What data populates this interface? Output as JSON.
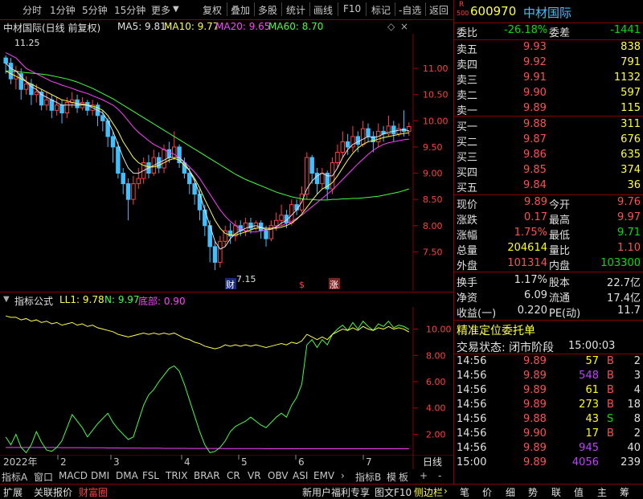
{
  "toolbar": {
    "left": [
      "分时",
      "1分钟",
      "5分钟",
      "15分钟",
      "更多"
    ],
    "right": [
      "复权",
      "叠加",
      "多股",
      "统计",
      "画线",
      "F10",
      "标记",
      "-自选",
      "返回"
    ]
  },
  "main_legend": {
    "title": "中材国际(日线 前复权)",
    "ma5": "MA5: 9.81",
    "ma10": "MA10: 9.77",
    "ma20": "MA20: 9.65",
    "ma60": "MA60: 8.70",
    "high_label": "11.25",
    "low_label": "7.15",
    "badges": [
      "财",
      "$",
      "涨"
    ]
  },
  "price_axis": [
    "11.00",
    "10.50",
    "10.00",
    "9.50",
    "9.00",
    "8.50",
    "8.00",
    "7.50"
  ],
  "indicator_legend": {
    "name": "指标公式",
    "ll1": "LL1: 9.78",
    "n": "N: 9.97",
    "dibu": "底部: 0.90"
  },
  "indicator_axis": [
    "10.00",
    "8.00",
    "6.00",
    "4.00",
    "2.00"
  ],
  "date_axis": {
    "year": "2022年",
    "months": [
      "2",
      "3",
      "4",
      "5",
      "6",
      "7"
    ],
    "period": "日线"
  },
  "bottom_tabs": [
    "指标A",
    "窗口",
    "MACD",
    "DMI",
    "DMA",
    "FSL",
    "TRIX",
    "BRAR",
    "CR",
    "VR",
    "OBV",
    "ASI",
    "EMV"
  ],
  "bottom_tabs_right": [
    "指标B",
    "模",
    "板",
    "+",
    "-"
  ],
  "status_left": [
    "扩展",
    "关联报价",
    "财富圈"
  ],
  "status_right": [
    "新用户福利专享",
    "图文F10",
    "侧边栏"
  ],
  "status_icons": [
    "笔",
    "价",
    "细",
    "势",
    "联",
    "值",
    "主",
    "筹"
  ],
  "quote": {
    "r_label": "R",
    "r_num": "500",
    "code": "600970",
    "name": "中材国际",
    "weibi_label": "委比",
    "weibi": "-26.18%",
    "weicha_label": "委差",
    "weicha": "-1441",
    "asks": [
      {
        "label": "卖五",
        "price": "9.93",
        "vol": "838"
      },
      {
        "label": "卖四",
        "price": "9.92",
        "vol": "791"
      },
      {
        "label": "卖三",
        "price": "9.91",
        "vol": "1132"
      },
      {
        "label": "卖二",
        "price": "9.90",
        "vol": "597"
      },
      {
        "label": "卖一",
        "price": "9.89",
        "vol": "115"
      }
    ],
    "bids": [
      {
        "label": "买一",
        "price": "9.88",
        "vol": "311"
      },
      {
        "label": "买二",
        "price": "9.87",
        "vol": "676"
      },
      {
        "label": "买三",
        "price": "9.86",
        "vol": "635"
      },
      {
        "label": "买四",
        "price": "9.85",
        "vol": "374"
      },
      {
        "label": "买五",
        "price": "9.84",
        "vol": "36"
      }
    ],
    "stats": [
      {
        "l1": "现价",
        "v1": "9.89",
        "l2": "今开",
        "v2": "9.76",
        "c1": "#ff5050",
        "c2": "#ff5050"
      },
      {
        "l1": "涨跌",
        "v1": "0.17",
        "l2": "最高",
        "v2": "9.97",
        "c1": "#ff5050",
        "c2": "#ff5050"
      },
      {
        "l1": "涨幅",
        "v1": "1.75%",
        "l2": "最低",
        "v2": "9.71",
        "c1": "#ff5050",
        "c2": "#00e000"
      },
      {
        "l1": "总量",
        "v1": "204614",
        "l2": "量比",
        "v2": "1.10",
        "c1": "#ffff00",
        "c2": "#ff5050"
      },
      {
        "l1": "外盘",
        "v1": "101314",
        "l2": "内盘",
        "v2": "103300",
        "c1": "#ff5050",
        "c2": "#00e000"
      }
    ],
    "fin": [
      {
        "l1": "换手",
        "v1": "1.17%",
        "l2": "股本",
        "v2": "22.7亿"
      },
      {
        "l1": "净资",
        "v1": "6.09",
        "l2": "流通",
        "v2": "17.4亿"
      },
      {
        "l1": "收益(一)",
        "v1": "0.220",
        "l2": "PE(动)",
        "v2": "11.7"
      }
    ],
    "precise_title": "精准定位委托单",
    "trade_status_label": "交易状态: 闭市阶段",
    "trade_status_time": "15:00:03",
    "ticks": [
      {
        "t": "14:56",
        "p": "9.89",
        "v": "57",
        "s": "B",
        "n": "2",
        "vc": "#ffff00"
      },
      {
        "t": "14:56",
        "p": "9.89",
        "v": "548",
        "s": "B",
        "n": "3",
        "vc": "#c040ff"
      },
      {
        "t": "14:56",
        "p": "9.89",
        "v": "61",
        "s": "B",
        "n": "4",
        "vc": "#ffff00"
      },
      {
        "t": "14:56",
        "p": "9.89",
        "v": "273",
        "s": "B",
        "n": "18",
        "vc": "#ffff00"
      },
      {
        "t": "14:56",
        "p": "9.88",
        "v": "43",
        "s": "S",
        "n": "8",
        "vc": "#ffff00"
      },
      {
        "t": "14:56",
        "p": "9.90",
        "v": "17",
        "s": "B",
        "n": "2",
        "vc": "#ffff00"
      },
      {
        "t": "14:56",
        "p": "9.89",
        "v": "945",
        "s": "",
        "n": "40",
        "vc": "#c040ff"
      },
      {
        "t": "15:00",
        "p": "9.89",
        "v": "4056",
        "s": "",
        "n": "239",
        "vc": "#c040ff"
      }
    ]
  },
  "chart_data": {
    "type": "candlestick",
    "ylim": [
      7.0,
      11.6
    ],
    "candles": [
      [
        11.2,
        11.1,
        11.25,
        10.9
      ],
      [
        11.1,
        10.8,
        11.2,
        10.7
      ],
      [
        10.8,
        10.95,
        11.05,
        10.6
      ],
      [
        10.9,
        10.6,
        11.0,
        10.4
      ],
      [
        10.6,
        10.7,
        10.85,
        10.5
      ],
      [
        10.7,
        10.5,
        10.8,
        10.3
      ],
      [
        10.5,
        10.55,
        10.7,
        10.35
      ],
      [
        10.55,
        10.3,
        10.6,
        10.2
      ],
      [
        10.3,
        10.4,
        10.55,
        10.2
      ],
      [
        10.4,
        10.2,
        10.5,
        10.05
      ],
      [
        10.2,
        10.3,
        10.45,
        10.1
      ],
      [
        10.3,
        10.15,
        10.4,
        9.95
      ],
      [
        10.15,
        10.35,
        10.45,
        10.05
      ],
      [
        10.35,
        10.4,
        10.55,
        10.25
      ],
      [
        10.4,
        10.25,
        10.5,
        10.15
      ],
      [
        10.25,
        10.35,
        10.45,
        10.2
      ],
      [
        10.35,
        10.2,
        10.4,
        10.1
      ],
      [
        10.2,
        10.3,
        10.4,
        10.1
      ],
      [
        10.3,
        10.1,
        10.35,
        9.9
      ],
      [
        10.1,
        10.0,
        10.2,
        9.8
      ],
      [
        10.0,
        9.7,
        10.05,
        9.5
      ],
      [
        9.7,
        9.5,
        9.8,
        9.2
      ],
      [
        9.5,
        9.0,
        9.6,
        8.9
      ],
      [
        9.0,
        8.8,
        9.1,
        8.6
      ],
      [
        8.8,
        8.5,
        8.9,
        8.1
      ],
      [
        8.5,
        8.8,
        8.95,
        8.4
      ],
      [
        8.8,
        8.9,
        9.1,
        8.7
      ],
      [
        8.9,
        9.2,
        9.3,
        8.8
      ],
      [
        9.2,
        9.0,
        9.35,
        8.9
      ],
      [
        9.0,
        9.3,
        9.45,
        8.95
      ],
      [
        9.3,
        9.1,
        9.4,
        9.0
      ],
      [
        9.1,
        9.45,
        9.55,
        9.0
      ],
      [
        9.45,
        9.3,
        9.6,
        9.2
      ],
      [
        9.3,
        9.5,
        9.8,
        9.25
      ],
      [
        9.5,
        9.2,
        9.55,
        9.1
      ],
      [
        9.2,
        9.0,
        9.3,
        8.9
      ],
      [
        9.0,
        8.8,
        9.1,
        8.6
      ],
      [
        8.8,
        8.6,
        8.9,
        8.4
      ],
      [
        8.6,
        8.3,
        8.7,
        8.1
      ],
      [
        8.3,
        8.0,
        8.4,
        7.8
      ],
      [
        8.0,
        7.6,
        8.1,
        7.3
      ],
      [
        7.6,
        7.3,
        7.7,
        7.15
      ],
      [
        7.3,
        7.7,
        7.8,
        7.2
      ],
      [
        7.7,
        7.9,
        8.0,
        7.6
      ],
      [
        7.9,
        7.8,
        8.05,
        7.65
      ],
      [
        7.8,
        8.0,
        8.1,
        7.7
      ],
      [
        8.0,
        7.9,
        8.1,
        7.8
      ],
      [
        7.9,
        8.05,
        8.15,
        7.8
      ],
      [
        8.05,
        7.95,
        8.15,
        7.85
      ],
      [
        7.95,
        8.05,
        8.1,
        7.9
      ],
      [
        8.05,
        7.9,
        8.1,
        7.75
      ],
      [
        7.9,
        7.75,
        8.0,
        7.6
      ],
      [
        7.75,
        8.0,
        8.1,
        7.7
      ],
      [
        8.0,
        8.1,
        8.25,
        7.9
      ],
      [
        8.1,
        8.2,
        8.4,
        8.0
      ],
      [
        8.2,
        8.05,
        8.3,
        7.95
      ],
      [
        8.05,
        8.4,
        8.5,
        8.0
      ],
      [
        8.4,
        8.3,
        8.5,
        8.2
      ],
      [
        8.3,
        8.6,
        8.75,
        8.25
      ],
      [
        8.6,
        9.3,
        9.4,
        8.5
      ],
      [
        9.3,
        9.0,
        9.35,
        8.8
      ],
      [
        9.0,
        8.8,
        9.1,
        8.6
      ],
      [
        8.8,
        9.0,
        9.1,
        8.7
      ],
      [
        9.0,
        8.7,
        9.05,
        8.5
      ],
      [
        8.7,
        9.2,
        9.3,
        8.6
      ],
      [
        9.2,
        9.4,
        9.55,
        9.1
      ],
      [
        9.4,
        9.6,
        9.8,
        9.3
      ],
      [
        9.6,
        9.5,
        9.75,
        9.35
      ],
      [
        9.5,
        9.7,
        9.9,
        9.4
      ],
      [
        9.7,
        9.55,
        9.8,
        9.4
      ],
      [
        9.55,
        9.85,
        10.0,
        9.5
      ],
      [
        9.85,
        9.7,
        9.95,
        9.6
      ],
      [
        9.7,
        9.6,
        9.8,
        9.4
      ],
      [
        9.6,
        9.8,
        9.95,
        9.5
      ],
      [
        9.8,
        9.75,
        9.9,
        9.6
      ],
      [
        9.75,
        9.9,
        10.1,
        9.7
      ],
      [
        9.9,
        9.75,
        10.0,
        9.6
      ],
      [
        9.75,
        9.85,
        9.95,
        9.7
      ],
      [
        9.85,
        9.8,
        10.2,
        9.7
      ],
      [
        9.8,
        9.89,
        9.97,
        9.71
      ]
    ],
    "ma5": [
      11.1,
      11.0,
      10.95,
      10.85,
      10.75,
      10.65,
      10.6,
      10.5,
      10.45,
      10.4,
      10.35,
      10.3,
      10.3,
      10.3,
      10.3,
      10.3,
      10.3,
      10.25,
      10.2,
      10.15,
      10.0,
      9.8,
      9.55,
      9.3,
      9.1,
      9.0,
      9.0,
      9.05,
      9.1,
      9.15,
      9.2,
      9.25,
      9.3,
      9.3,
      9.3,
      9.2,
      9.05,
      8.85,
      8.6,
      8.3,
      8.0,
      7.7,
      7.55,
      7.6,
      7.75,
      7.85,
      7.9,
      7.95,
      7.98,
      8.0,
      7.97,
      7.92,
      7.93,
      7.97,
      8.05,
      8.1,
      8.2,
      8.3,
      8.45,
      8.7,
      8.85,
      8.95,
      9.0,
      8.95,
      8.95,
      9.1,
      9.3,
      9.45,
      9.55,
      9.6,
      9.65,
      9.7,
      9.68,
      9.7,
      9.75,
      9.78,
      9.8,
      9.82,
      9.83,
      9.81
    ],
    "ma10": [
      10.95,
      10.9,
      10.85,
      10.8,
      10.75,
      10.7,
      10.65,
      10.6,
      10.55,
      10.5,
      10.45,
      10.4,
      10.38,
      10.35,
      10.33,
      10.32,
      10.3,
      10.28,
      10.25,
      10.2,
      10.1,
      9.95,
      9.8,
      9.6,
      9.45,
      9.3,
      9.2,
      9.15,
      9.12,
      9.12,
      9.15,
      9.2,
      9.25,
      9.28,
      9.25,
      9.15,
      9.05,
      8.9,
      8.72,
      8.5,
      8.3,
      8.1,
      7.95,
      7.85,
      7.82,
      7.82,
      7.85,
      7.88,
      7.92,
      7.95,
      7.96,
      7.95,
      7.95,
      7.95,
      7.97,
      8.0,
      8.05,
      8.12,
      8.22,
      8.35,
      8.48,
      8.6,
      8.7,
      8.75,
      8.82,
      8.95,
      9.1,
      9.25,
      9.38,
      9.48,
      9.55,
      9.6,
      9.62,
      9.65,
      9.68,
      9.7,
      9.72,
      9.74,
      9.76,
      9.77
    ],
    "ma20": [
      11.3,
      11.25,
      11.2,
      11.1,
      11.0,
      10.95,
      10.9,
      10.85,
      10.8,
      10.75,
      10.72,
      10.68,
      10.65,
      10.62,
      10.58,
      10.55,
      10.52,
      10.48,
      10.44,
      10.4,
      10.35,
      10.3,
      10.22,
      10.12,
      10.0,
      9.88,
      9.78,
      9.7,
      9.62,
      9.55,
      9.5,
      9.45,
      9.4,
      9.36,
      9.3,
      9.22,
      9.12,
      9.02,
      8.9,
      8.75,
      8.6,
      8.45,
      8.3,
      8.18,
      8.08,
      8.0,
      7.94,
      7.9,
      7.88,
      7.88,
      7.9,
      7.92,
      7.95,
      7.98,
      8.0,
      8.04,
      8.08,
      8.14,
      8.2,
      8.28,
      8.36,
      8.44,
      8.52,
      8.6,
      8.68,
      8.78,
      8.88,
      8.98,
      9.08,
      9.18,
      9.27,
      9.36,
      9.44,
      9.5,
      9.55,
      9.58,
      9.6,
      9.62,
      9.64,
      9.65
    ],
    "ma60": [
      10.95,
      10.95,
      10.94,
      10.93,
      10.92,
      10.91,
      10.9,
      10.89,
      10.88,
      10.86,
      10.84,
      10.82,
      10.8,
      10.77,
      10.74,
      10.7,
      10.66,
      10.62,
      10.57,
      10.52,
      10.47,
      10.42,
      10.36,
      10.3,
      10.24,
      10.18,
      10.12,
      10.06,
      10.0,
      9.94,
      9.88,
      9.82,
      9.76,
      9.7,
      9.64,
      9.58,
      9.52,
      9.46,
      9.4,
      9.34,
      9.28,
      9.22,
      9.16,
      9.1,
      9.04,
      8.98,
      8.93,
      8.88,
      8.84,
      8.8,
      8.76,
      8.72,
      8.68,
      8.64,
      8.61,
      8.58,
      8.55,
      8.53,
      8.51,
      8.5,
      8.5,
      8.49,
      8.49,
      8.49,
      8.5,
      8.5,
      8.51,
      8.51,
      8.52,
      8.52,
      8.53,
      8.54,
      8.55,
      8.56,
      8.58,
      8.6,
      8.62,
      8.64,
      8.67,
      8.7
    ],
    "ind_ylim": [
      0.5,
      11.5
    ],
    "ll1": [
      11.0,
      10.9,
      10.9,
      10.7,
      10.8,
      10.6,
      10.7,
      10.5,
      10.6,
      10.4,
      10.5,
      10.3,
      10.4,
      10.5,
      10.3,
      10.4,
      10.2,
      10.3,
      10.1,
      10.0,
      9.9,
      9.8,
      9.6,
      9.5,
      9.4,
      9.5,
      9.6,
      9.7,
      9.6,
      9.7,
      9.6,
      9.7,
      9.6,
      9.7,
      9.5,
      9.3,
      9.2,
      9.0,
      8.9,
      8.7,
      8.6,
      8.5,
      8.6,
      8.8,
      8.7,
      8.8,
      8.7,
      8.8,
      8.7,
      8.8,
      8.7,
      8.6,
      8.7,
      8.8,
      8.9,
      8.8,
      9.0,
      8.9,
      9.1,
      9.6,
      9.4,
      9.2,
      9.4,
      9.2,
      9.6,
      9.8,
      10.0,
      9.9,
      10.1,
      9.9,
      10.2,
      10.0,
      9.9,
      10.1,
      10.0,
      10.2,
      10.0,
      10.1,
      10.0,
      9.78
    ],
    "n": [
      1.8,
      1.2,
      2.0,
      1.0,
      0.6,
      1.2,
      2.2,
      1.4,
      0.8,
      0.7,
      1.0,
      1.5,
      2.5,
      3.5,
      3.0,
      2.5,
      1.8,
      2.3,
      2.8,
      3.2,
      3.6,
      2.9,
      2.4,
      2.0,
      1.6,
      1.8,
      3.0,
      4.2,
      5.0,
      5.4,
      6.0,
      6.5,
      7.0,
      7.2,
      6.8,
      5.8,
      4.6,
      3.4,
      2.2,
      1.2,
      0.6,
      0.7,
      1.0,
      1.5,
      2.2,
      2.6,
      2.8,
      3.0,
      3.3,
      3.0,
      2.7,
      2.5,
      2.9,
      3.3,
      3.6,
      3.3,
      4.2,
      4.8,
      5.8,
      8.8,
      9.2,
      8.6,
      9.2,
      8.8,
      9.6,
      10.0,
      10.3,
      9.9,
      10.5,
      10.0,
      10.6,
      10.2,
      9.9,
      10.4,
      10.2,
      10.6,
      10.1,
      10.3,
      10.2,
      9.97
    ],
    "dibu": [
      1.0,
      1.0,
      1.0,
      1.0,
      1.0,
      1.0,
      1.0,
      1.0,
      1.0,
      1.0,
      1.0,
      0.98,
      0.98,
      0.98,
      0.98,
      0.98,
      0.97,
      0.97,
      0.97,
      0.97,
      0.96,
      0.96,
      0.96,
      0.95,
      0.95,
      0.95,
      0.95,
      0.94,
      0.94,
      0.94,
      0.94,
      0.93,
      0.93,
      0.93,
      0.93,
      0.93,
      0.92,
      0.92,
      0.92,
      0.92,
      0.92,
      0.92,
      0.91,
      0.91,
      0.91,
      0.91,
      0.91,
      0.91,
      0.91,
      0.91,
      0.91,
      0.9,
      0.9,
      0.9,
      0.9,
      0.9,
      0.9,
      0.9,
      0.9,
      0.9,
      0.9,
      0.9,
      0.9,
      0.9,
      0.9,
      0.9,
      0.9,
      0.9,
      0.9,
      0.9,
      0.9,
      0.9,
      0.9,
      0.9,
      0.9,
      0.9,
      0.9,
      0.9,
      0.9,
      0.9
    ]
  }
}
